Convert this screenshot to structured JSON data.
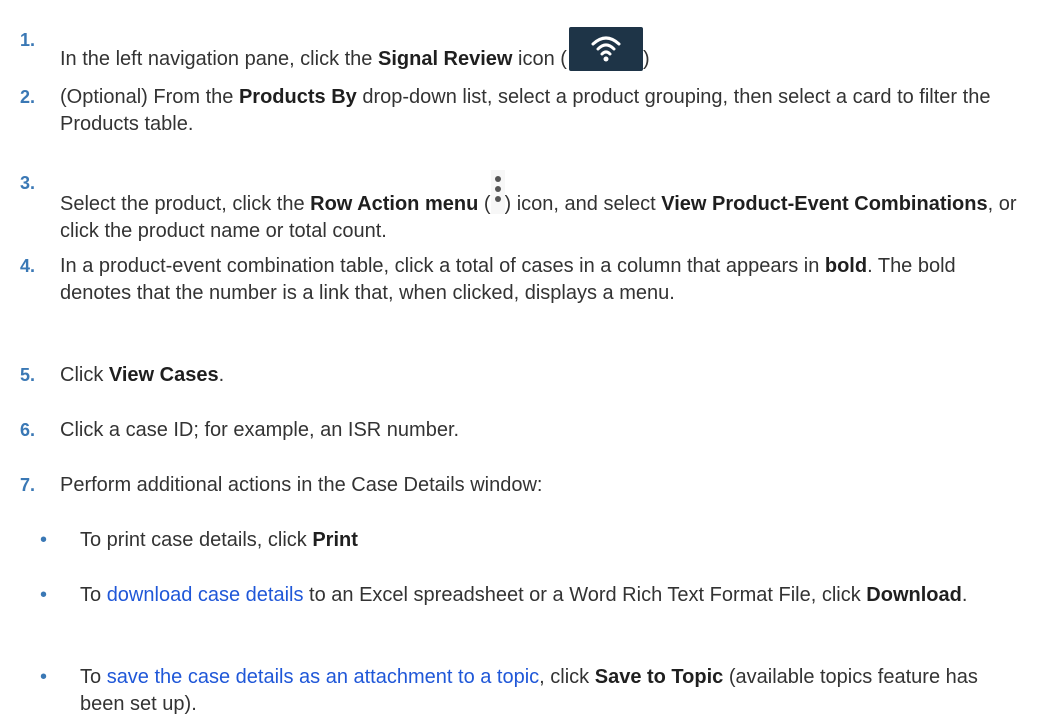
{
  "steps": [
    {
      "num": "1.",
      "t1": "In the left navigation pane, click the ",
      "b1": "Signal Review",
      "t2": " icon (",
      "t3": ")"
    },
    {
      "num": "2.",
      "t1": "(Optional) From the ",
      "b1": "Products By",
      "t2": " drop-down list, select a product grouping, then select a card to filter the Products table."
    },
    {
      "num": "3.",
      "t1": "Select the product, click the ",
      "b1": "Row Action menu",
      "t2": " (",
      "t3": ") icon, and select ",
      "b2": "View Product-Event Combinations",
      "t4": ", or click the product name or total count."
    },
    {
      "num": "4.",
      "t1": "In a product-event combination table, click a total of cases in a column that appears in ",
      "b1": "bold",
      "t2": ". The bold denotes that the number is a link that, when clicked, displays a menu."
    },
    {
      "num": "5.",
      "t1": "Click ",
      "b1": "View Cases",
      "t2": "."
    },
    {
      "num": "6.",
      "t1": "Click a case ID; for example, an ISR number."
    },
    {
      "num": "7.",
      "t1": "Perform additional actions in the Case Details window:"
    }
  ],
  "bullets": [
    {
      "symbol": "•",
      "t1": "To print case details, click ",
      "b1": "Print"
    },
    {
      "symbol": "•",
      "t1": "To ",
      "link": "download case details",
      "t2": " to an Excel spreadsheet or a Word Rich Text Format File, click ",
      "b1": "Download",
      "t3": "."
    },
    {
      "symbol": "•",
      "t1": "To ",
      "link": "save the case details as an attachment to a topic",
      "t2": ", click ",
      "b1": "Save to Topic",
      "t3": " (available topics feature has been set up)."
    }
  ],
  "icons": {
    "signal_review": "wifi-icon",
    "row_action": "kebab-menu-icon"
  },
  "colors": {
    "step_number": "#3a78b5",
    "link": "#1f57d8",
    "icon_background": "#1e3447"
  }
}
